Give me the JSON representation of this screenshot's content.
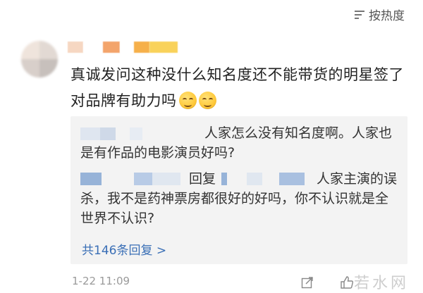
{
  "sort": {
    "label": "按热度",
    "icon": "sort-icon"
  },
  "comment": {
    "text": "真诚发问这种没什么知名度还不能带货的明星签了对品牌有助力吗",
    "emoji": [
      "grin-emoji",
      "grin-emoji"
    ]
  },
  "replies": [
    {
      "text": "人家怎么没有知名度啊。人家也是有作品的电影演员好吗?"
    },
    {
      "reply_label": "回复",
      "line1": "人家主演的误",
      "rest": "杀，我不是药神票房都很好的好吗，你不认识就是全世界不认识?"
    }
  ],
  "reply_count": "共146条回复 >",
  "timestamp": "1-22 11:09",
  "watermark": "若水网",
  "colors": {
    "link": "#3a6fb6",
    "reply_bg": "#f3f3f3",
    "time": "#9a9a9a"
  }
}
